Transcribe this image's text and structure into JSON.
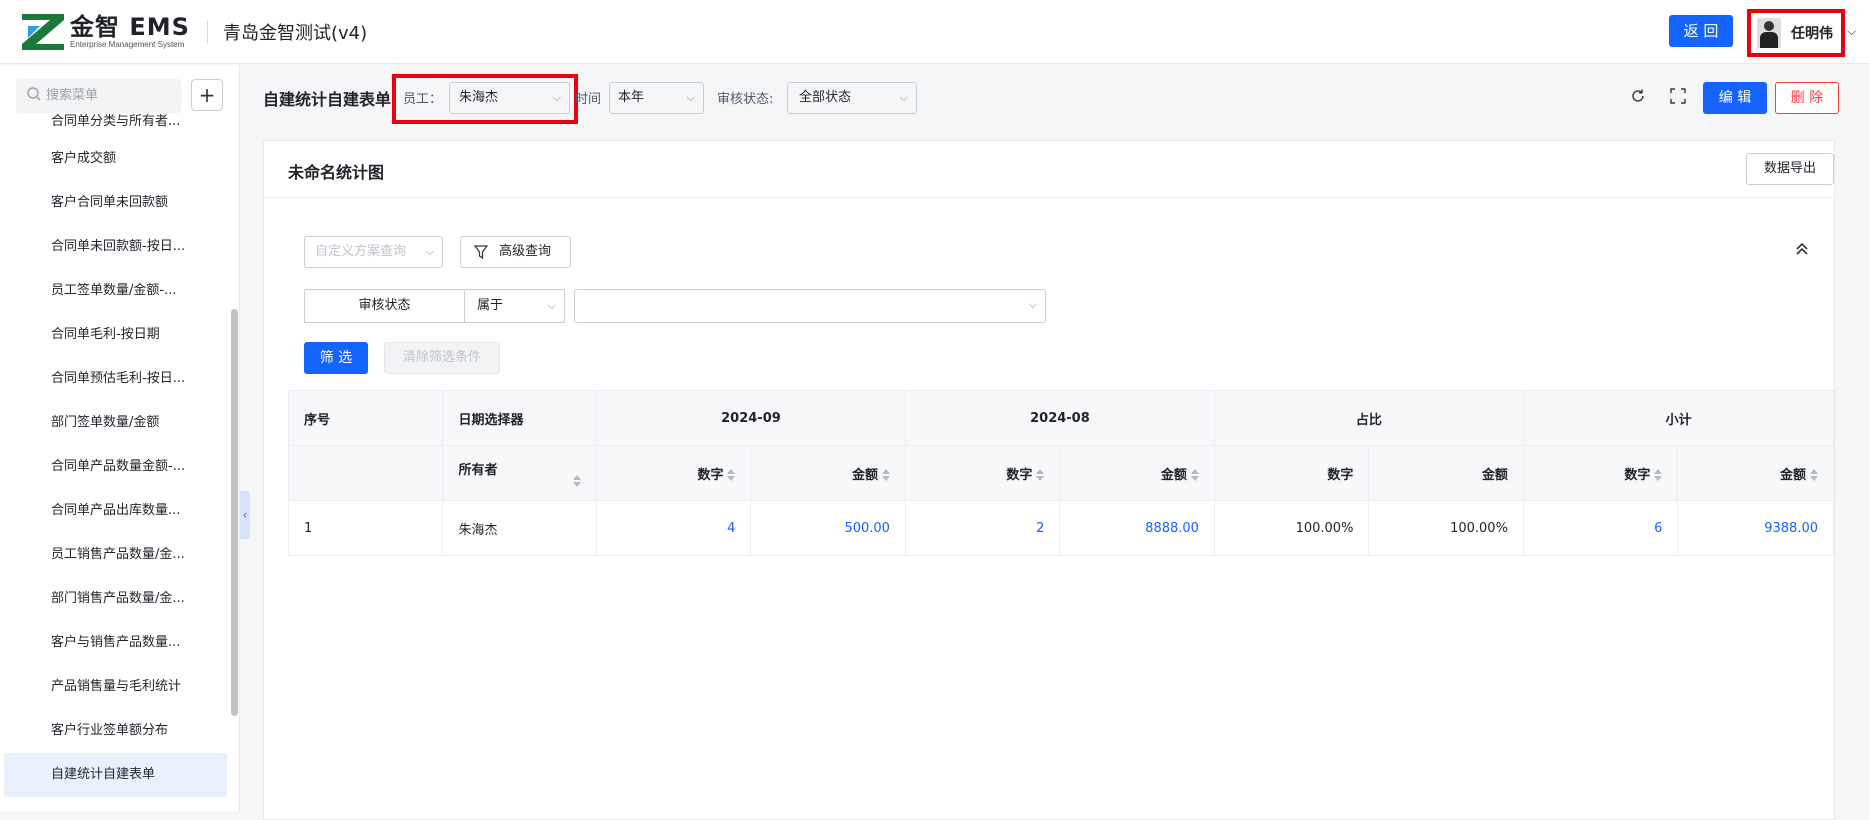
{
  "app": {
    "logo_text": "金智 EMS",
    "logo_sub": "Enterprise Management System",
    "company": "青岛金智测试(v4)",
    "back_label": "返 回",
    "user_name": "任明伟"
  },
  "sidebar": {
    "search_placeholder": "搜索菜单",
    "items": [
      "合同单分类与所有者...",
      "客户成交额",
      "客户合同单未回款额",
      "合同单未回款额-按日...",
      "员工签单数量/金额-...",
      "合同单毛利-按日期",
      "合同单预估毛利-按日...",
      "部门签单数量/金额",
      "合同单产品数量金额-...",
      "合同单产品出库数量...",
      "员工销售产品数量/金...",
      "部门销售产品数量/金...",
      "客户与销售产品数量...",
      "产品销售量与毛利统计",
      "客户行业签单额分布",
      "自建统计自建表单"
    ],
    "active_index": 15
  },
  "toolbar": {
    "page_title": "自建统计自建表单",
    "employee_label": "员工：",
    "employee_value": "朱海杰",
    "time_label": "时间",
    "time_value": "本年",
    "audit_label": "审核状态:",
    "audit_value": "全部状态",
    "edit_label": "编 辑",
    "delete_label": "删 除"
  },
  "card": {
    "title": "未命名统计图",
    "export_label": "数据导出",
    "scheme_placeholder": "自定义方案查询",
    "advanced_label": "高级查询",
    "condition_field": "审核状态",
    "condition_op": "属于",
    "condition_value": "",
    "apply_label": "筛 选",
    "clear_label": "清除筛选条件"
  },
  "table": {
    "group_headers": {
      "seq": "序号",
      "date_picker": "日期选择器",
      "col1": "2024-09",
      "col2": "2024-08",
      "col3": "占比",
      "col4": "小计"
    },
    "sub_headers": {
      "owner": "所有者",
      "num": "数字",
      "amount": "金额"
    },
    "rows": [
      {
        "seq": "1",
        "owner": "朱海杰",
        "sep_num": "4",
        "sep_amount": "500.00",
        "aug_num": "2",
        "aug_amount": "8888.00",
        "ratio_num": "100.00%",
        "ratio_amount": "100.00%",
        "sub_num": "6",
        "sub_amount": "9388.00"
      }
    ]
  },
  "colors": {
    "primary": "#1664ff",
    "danger": "#f53f3f",
    "highlight_box": "#e60012"
  }
}
